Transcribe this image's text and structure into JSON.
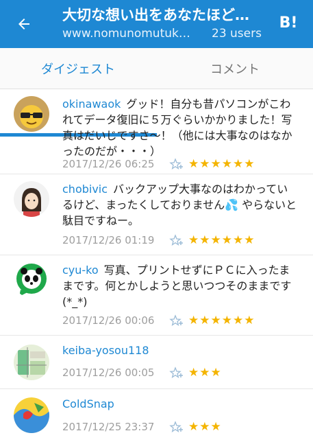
{
  "header": {
    "title": "大切な想い出をあなたほど…",
    "url": "www.nomunomutuk…",
    "users": "23 users"
  },
  "tabs": [
    {
      "label": "ダイジェスト",
      "active": true
    },
    {
      "label": "コメント",
      "active": false
    }
  ],
  "comments": [
    {
      "user": "okinawaok",
      "text": "グッド！自分も昔パソコンがこわれてデータ復旧に５万ぐらいかかりました！写真はだいじですさ〜！（他には大事なのはなかったのだが・・・）",
      "date": "2017/12/26 06:25",
      "stars": "★★★★★★",
      "avatar_icon": "sunglasses-face-icon"
    },
    {
      "user": "chobivic",
      "text": "バックアップ大事なのはわかっているけど、まったくしておりません💦 やらないと駄目ですねー。",
      "date": "2017/12/26 01:19",
      "stars": "★★★★★★",
      "avatar_icon": "girl-avatar-icon"
    },
    {
      "user": "cyu-ko",
      "text": "写真、プリントせずにＰＣに入ったままです。何とかしようと思いつつそのままです(*_*)",
      "date": "2017/12/26 00:06",
      "stars": "★★★★★★",
      "avatar_icon": "panda-bubble-icon"
    },
    {
      "user": "keiba-yosou118",
      "text": "",
      "date": "2017/12/26 00:05",
      "stars": "★★★",
      "avatar_icon": "map-avatar-icon"
    },
    {
      "user": "ColdSnap",
      "text": "",
      "date": "2017/12/25 23:37",
      "stars": "★★★",
      "avatar_icon": "colorful-avatar-icon"
    }
  ],
  "colors": {
    "accent": "#1e88d3",
    "star": "#f4b400",
    "muted": "#9e9e9e"
  }
}
